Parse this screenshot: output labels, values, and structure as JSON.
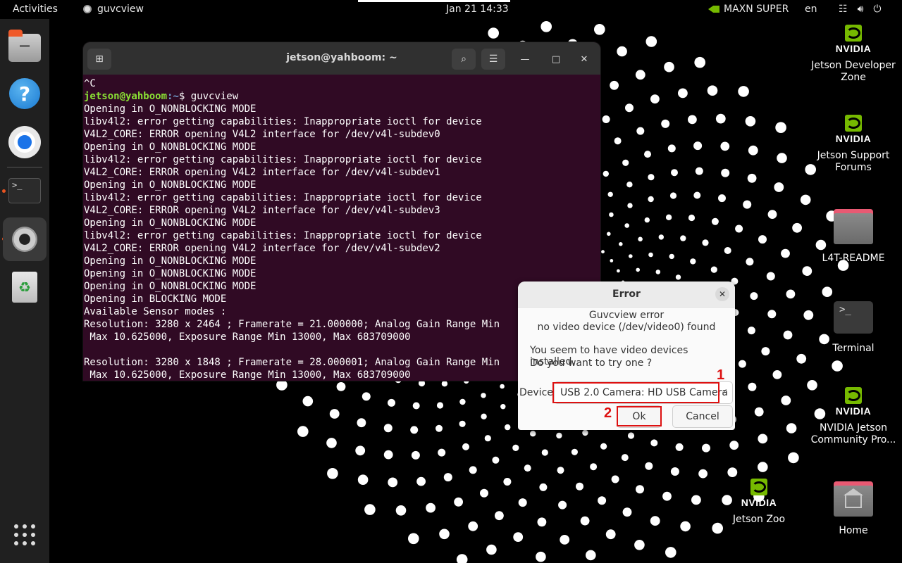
{
  "topbar": {
    "activities": "Activities",
    "app_name": "guvcview",
    "clock": "Jan 21  14:33",
    "power_mode": "MAXN SUPER",
    "language": "en",
    "icons": [
      "network-icon",
      "accessibility-icon",
      "power-icon"
    ]
  },
  "dock": {
    "items": [
      "files",
      "help",
      "chromium",
      "terminal",
      "guvcview",
      "trash",
      "show-apps"
    ]
  },
  "terminal": {
    "title": "jetson@yahboom: ~",
    "prompt_user": "jetson@yahboom",
    "prompt_path": ":~",
    "prompt_symbol": "$ ",
    "command": "guvcview",
    "first_line": "^C",
    "output": [
      "Opening in O_NONBLOCKING MODE",
      "libv4l2: error getting capabilities: Inappropriate ioctl for device",
      "V4L2_CORE: ERROR opening V4L2 interface for /dev/v4l-subdev0",
      "Opening in O_NONBLOCKING MODE",
      "libv4l2: error getting capabilities: Inappropriate ioctl for device",
      "V4L2_CORE: ERROR opening V4L2 interface for /dev/v4l-subdev1",
      "Opening in O_NONBLOCKING MODE",
      "libv4l2: error getting capabilities: Inappropriate ioctl for device",
      "V4L2_CORE: ERROR opening V4L2 interface for /dev/v4l-subdev3",
      "Opening in O_NONBLOCKING MODE",
      "libv4l2: error getting capabilities: Inappropriate ioctl for device",
      "V4L2_CORE: ERROR opening V4L2 interface for /dev/v4l-subdev2",
      "Opening in O_NONBLOCKING MODE",
      "Opening in O_NONBLOCKING MODE",
      "Opening in O_NONBLOCKING MODE",
      "Opening in BLOCKING MODE",
      "Available Sensor modes :",
      "Resolution: 3280 x 2464 ; Framerate = 21.000000; Analog Gain Range Min",
      " Max 10.625000, Exposure Range Min 13000, Max 683709000",
      "",
      "Resolution: 3280 x 1848 ; Framerate = 28.000001; Analog Gain Range Min",
      " Max 10.625000, Exposure Range Min 13000, Max 683709000"
    ]
  },
  "dialog": {
    "title": "Error",
    "line1": "Guvcview error",
    "line2": "no video device (/dev/video0) found",
    "line3": "You seem to have video devices installed.",
    "line4": "Do you want to try one ?",
    "device_label": "Device:",
    "device_value": "USB 2.0 Camera: HD USB Camera",
    "ok_label": "Ok",
    "cancel_label": "Cancel",
    "annotation_1": "1",
    "annotation_2": "2",
    "annotation_color": "#dd1111"
  },
  "desktop": {
    "nvidia_wordmark": "NVIDIA",
    "icons": [
      {
        "label": "Jetson Developer Zone"
      },
      {
        "label": "Jetson Support Forums"
      },
      {
        "label": "L4T-README"
      },
      {
        "label": "Terminal"
      },
      {
        "label": "NVIDIA Jetson Community Pro..."
      },
      {
        "label": "Jetson Zoo"
      },
      {
        "label": "Home"
      }
    ]
  },
  "colors": {
    "terminal_bg": "#300a24",
    "nvidia_green": "#76b900",
    "ubuntu_orange": "#e95420"
  }
}
